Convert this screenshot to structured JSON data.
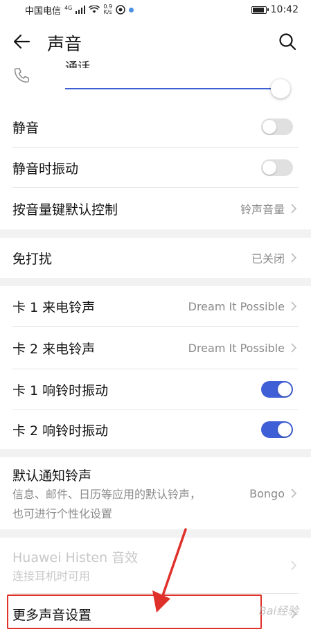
{
  "status_bar": {
    "carrier": "中国电信",
    "network": "4G",
    "speed_value": "0.9",
    "speed_unit": "K/s",
    "time": "10:42",
    "battery_level": 0.9
  },
  "header": {
    "title": "声音",
    "back_icon": "arrow-left-icon",
    "search_icon": "search-icon"
  },
  "volume": {
    "label": "通话",
    "icon": "phone-icon",
    "level": 0.99
  },
  "rows": {
    "mute": {
      "label": "静音",
      "on": false
    },
    "vibrate_silent": {
      "label": "静音时振动",
      "on": false
    },
    "volume_key": {
      "label": "按音量键默认控制",
      "value": "铃声音量"
    },
    "dnd": {
      "label": "免打扰",
      "value": "已关闭"
    },
    "sim1_ringtone": {
      "label": "卡 1 来电铃声",
      "value": "Dream It Possible"
    },
    "sim2_ringtone": {
      "label": "卡 2 来电铃声",
      "value": "Dream It Possible"
    },
    "sim1_vibrate": {
      "label": "卡 1 响铃时振动",
      "on": true
    },
    "sim2_vibrate": {
      "label": "卡 2 响铃时振动",
      "on": true
    },
    "notification": {
      "label": "默认通知铃声",
      "sub_line1": "信息、邮件、日历等应用的默认铃声，",
      "sub_line2": "也可进行个性化设置",
      "value": "Bongo"
    },
    "histen": {
      "label": "Huawei Histen 音效",
      "sub": "连接耳机时可用"
    },
    "more": {
      "label": "更多声音设置"
    }
  },
  "colors": {
    "accent": "#3f5fd6",
    "highlight": "#e0302a"
  },
  "watermark": "Bai经验"
}
